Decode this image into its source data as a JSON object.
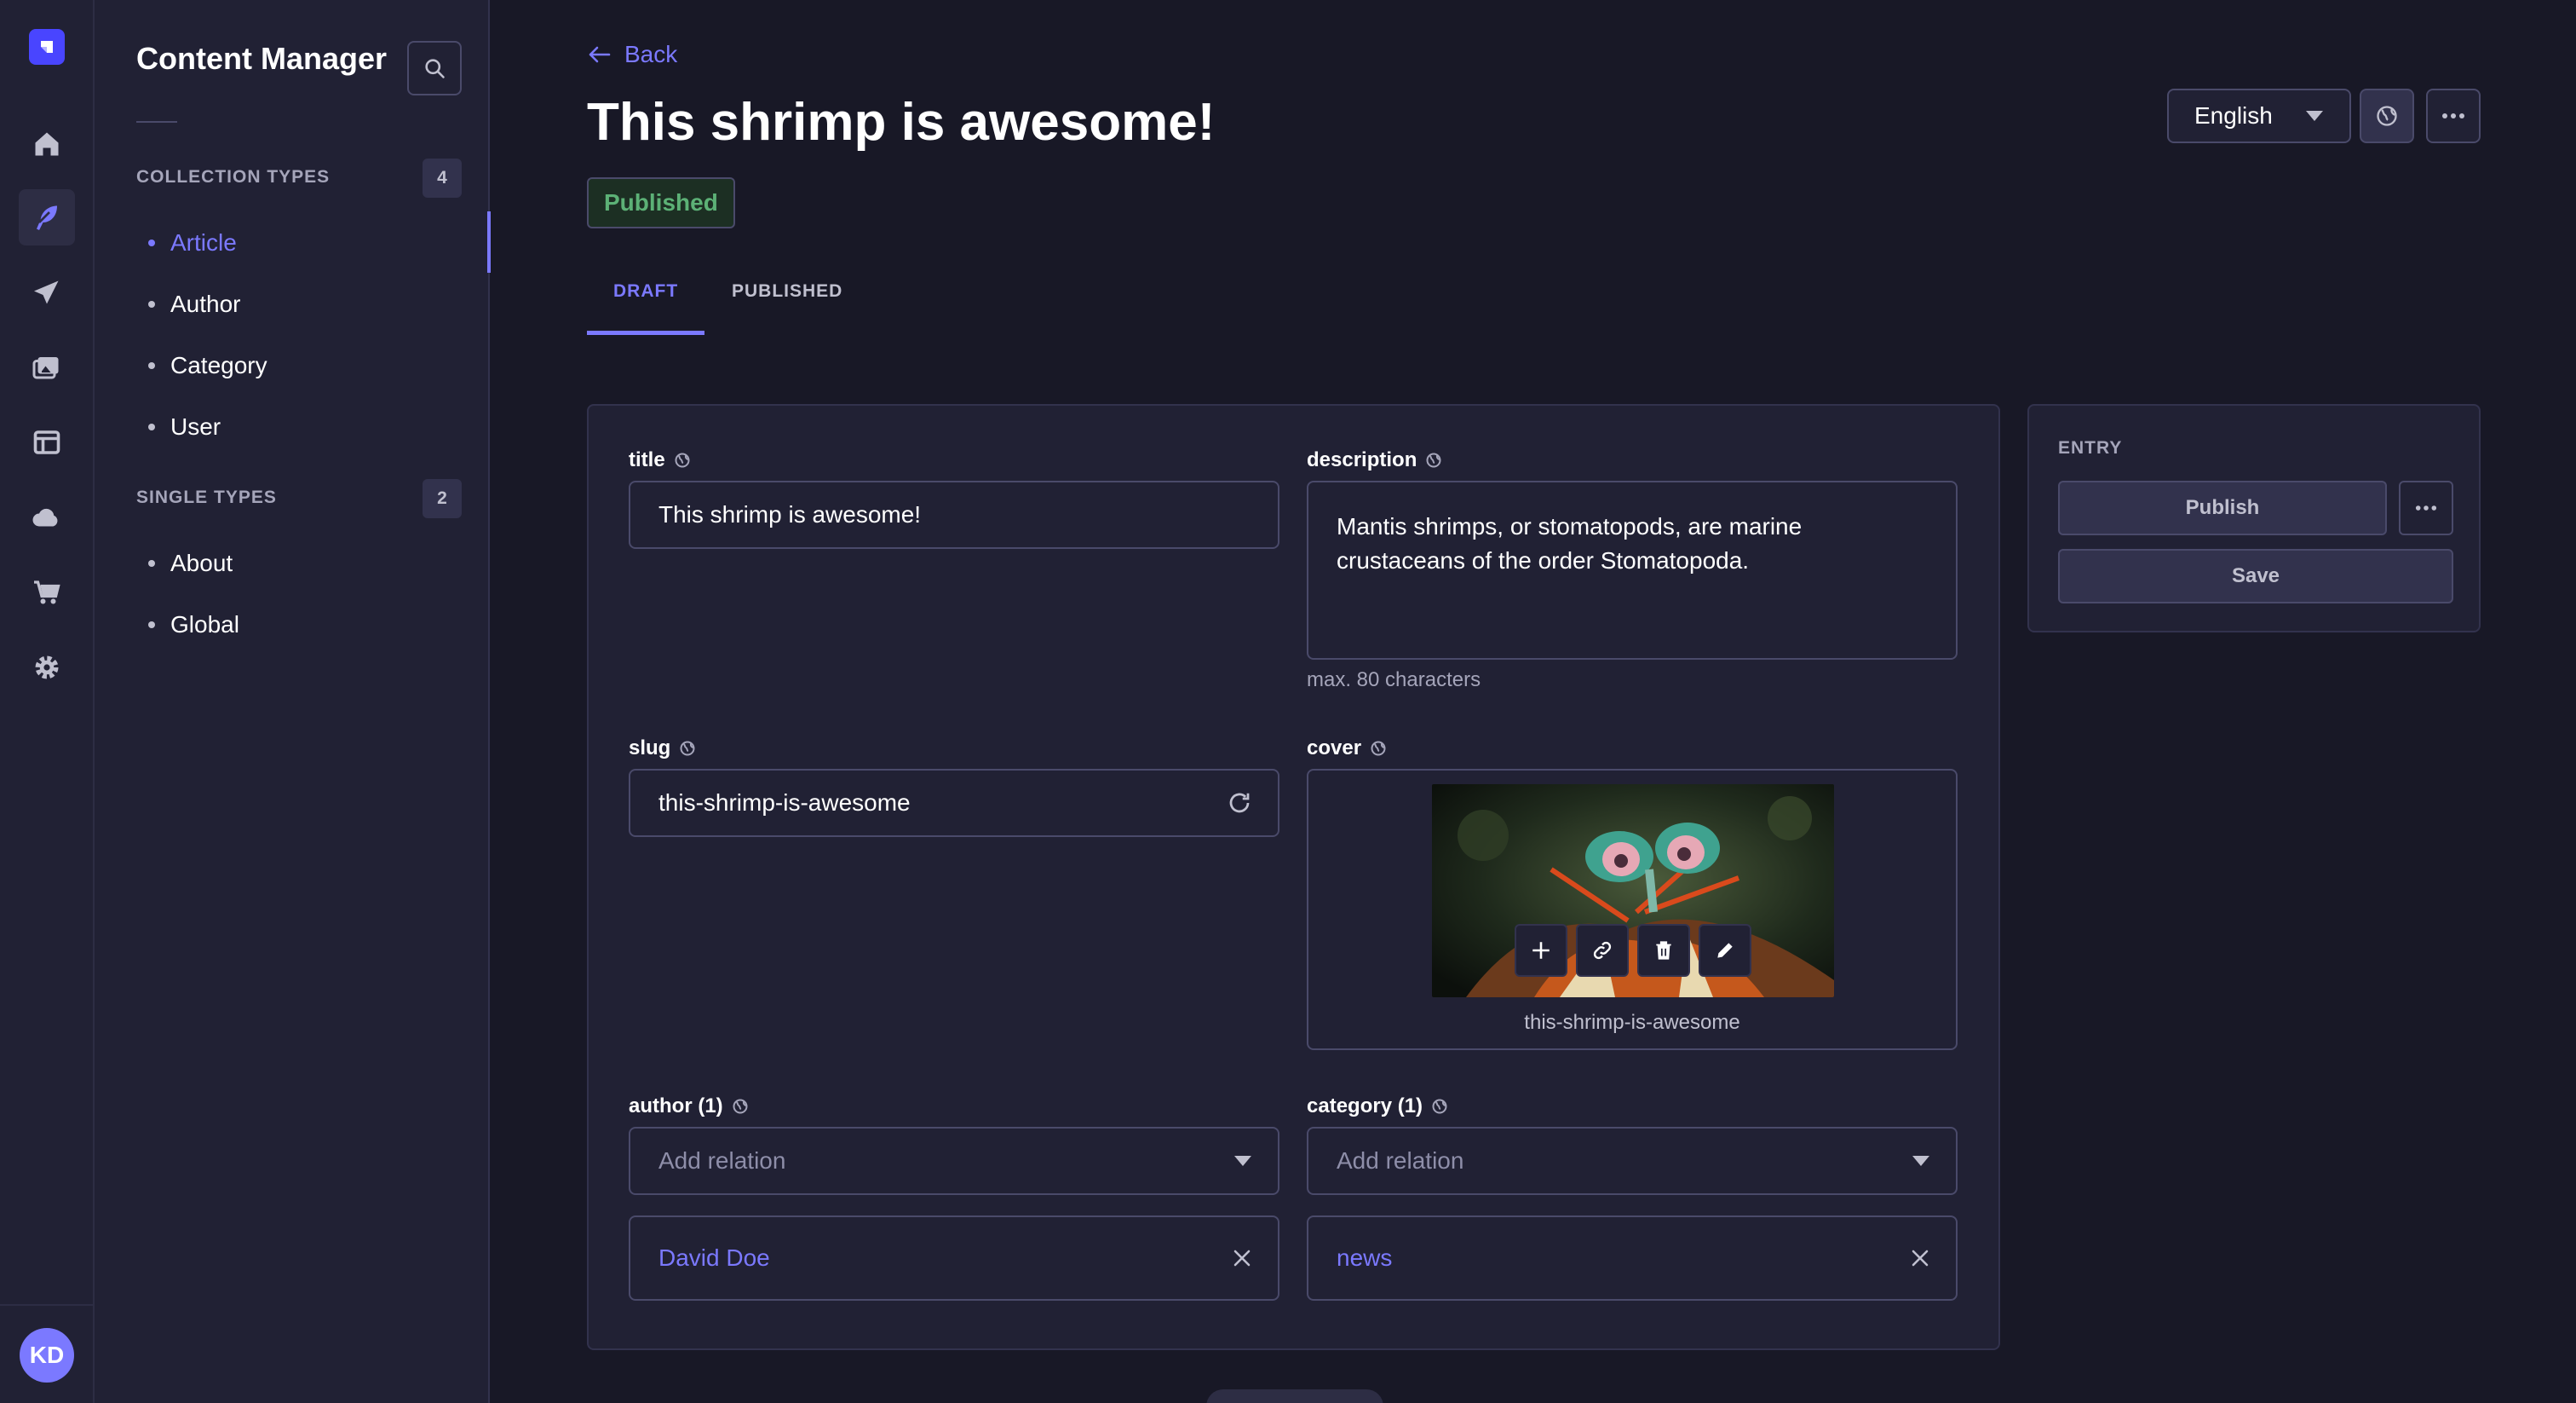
{
  "rail": {
    "avatar_initials": "KD",
    "icons": [
      "strapi-logo-icon",
      "home-icon",
      "feather-icon",
      "paper-plane-icon",
      "images-icon",
      "layout-icon",
      "cloud-icon",
      "cart-icon",
      "gear-icon"
    ]
  },
  "subnav": {
    "title": "Content Manager",
    "collection_label": "COLLECTION TYPES",
    "collection_count": "4",
    "collection_items": [
      "Article",
      "Author",
      "Category",
      "User"
    ],
    "single_label": "SINGLE TYPES",
    "single_count": "2",
    "single_items": [
      "About",
      "Global"
    ]
  },
  "header": {
    "back_label": "Back",
    "title": "This shrimp is awesome!",
    "status": "Published",
    "locale": "English"
  },
  "tabs": [
    "DRAFT",
    "PUBLISHED"
  ],
  "form": {
    "title_label": "title",
    "title_value": "This shrimp is awesome!",
    "description_label": "description",
    "description_value": "Mantis shrimps, or stomatopods, are marine crustaceans of the order Stomatopoda.",
    "description_hint": "max. 80 characters",
    "slug_label": "slug",
    "slug_value": "this-shrimp-is-awesome",
    "cover_label": "cover",
    "cover_caption": "this-shrimp-is-awesome",
    "author_label": "author (1)",
    "author_placeholder": "Add relation",
    "author_value": "David Doe",
    "category_label": "category (1)",
    "category_placeholder": "Add relation",
    "category_value": "news"
  },
  "entry": {
    "label": "ENTRY",
    "publish_label": "Publish",
    "save_label": "Save"
  },
  "colors": {
    "accent": "#7b79ff",
    "published_green": "#5cb176",
    "background": "#181826",
    "panel": "#212134"
  }
}
